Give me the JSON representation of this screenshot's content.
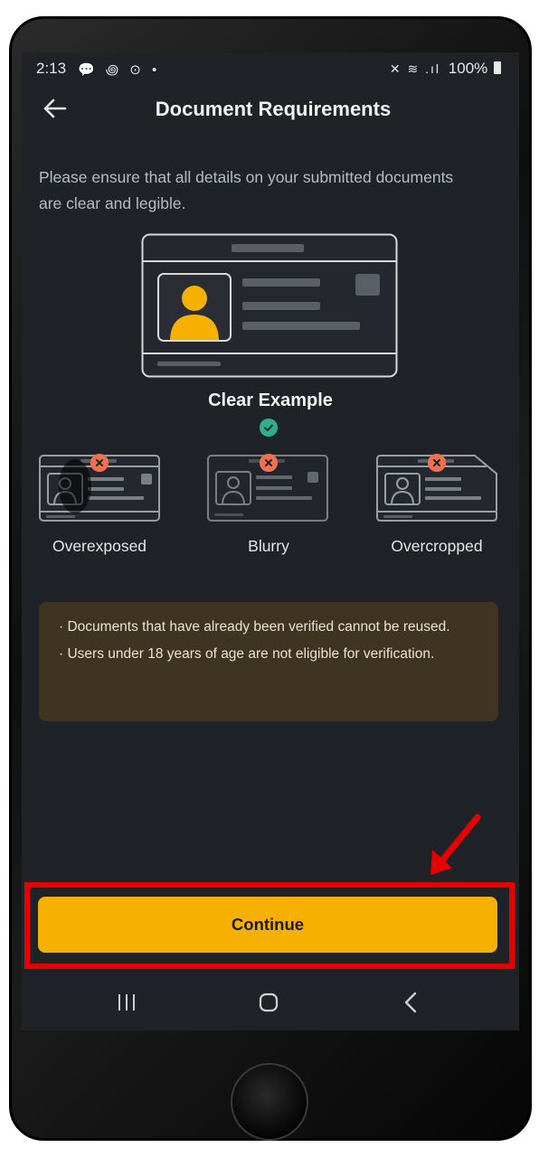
{
  "status_bar": {
    "time": "2:13",
    "notification_icons": "💬 ꩜ ⊙ •",
    "system_icons": "✕ ≋ .ıl",
    "battery": "100%"
  },
  "header": {
    "title": "Document Requirements",
    "back_icon": "arrow-left-icon"
  },
  "intro_text": "Please ensure that all details on your submitted documents are clear and legible.",
  "clear_example": {
    "label": "Clear Example",
    "status_icon": "check-icon",
    "status_color": "#2bb08a"
  },
  "examples": [
    {
      "label": "Overexposed",
      "status_icon": "x-icon"
    },
    {
      "label": "Blurry",
      "status_icon": "x-icon"
    },
    {
      "label": "Overcropped",
      "status_icon": "x-icon"
    }
  ],
  "notices": [
    "·  Documents that have already been verified cannot be reused.",
    "·  Users under 18 years of age are not eligible for verification."
  ],
  "continue_button": {
    "label": "Continue",
    "color": "#f5b000"
  },
  "colors": {
    "background": "#1f2227",
    "accent": "#f5b000",
    "error": "#f0714f",
    "success": "#2bb08a",
    "highlight": "#e60000",
    "notice_bg": "#3e3420"
  },
  "nav_bar": {
    "recents_icon": "recents-icon",
    "home_icon": "home-icon",
    "back_icon": "chevron-left-icon"
  }
}
